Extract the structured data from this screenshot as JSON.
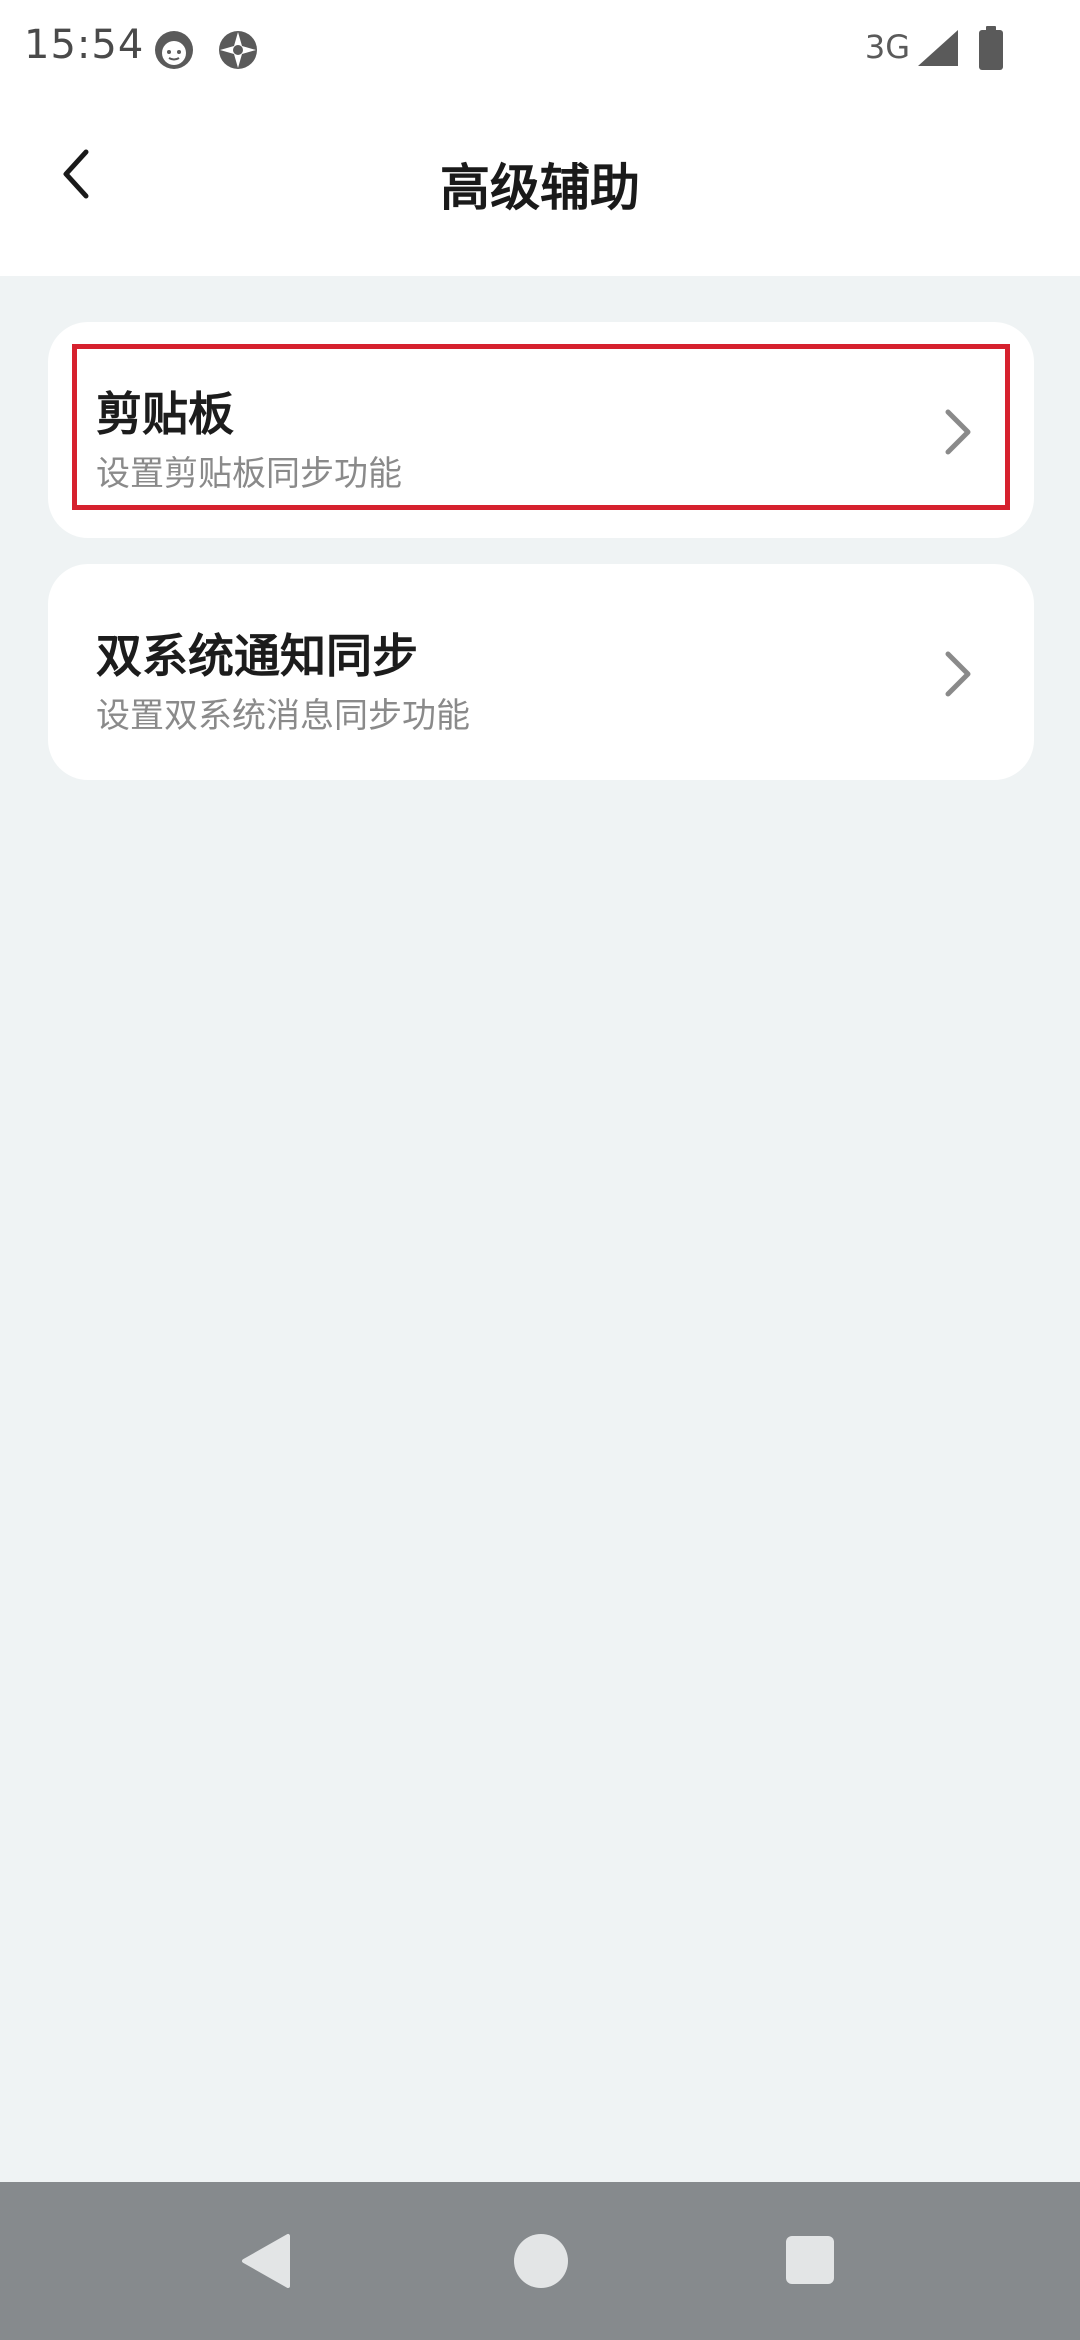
{
  "status_bar": {
    "time": "15:54",
    "network": "3G",
    "icons": [
      "face-icon",
      "browser-icon",
      "signal-icon",
      "battery-icon"
    ]
  },
  "header": {
    "title": "高级辅助",
    "back_icon": "chevron-left-icon"
  },
  "settings": [
    {
      "title": "剪贴板",
      "subtitle": "设置剪贴板同步功能",
      "highlighted": true
    },
    {
      "title": "双系统通知同步",
      "subtitle": "设置双系统消息同步功能",
      "highlighted": false
    }
  ],
  "nav_bar": {
    "icons": [
      "back-triangle-icon",
      "home-circle-icon",
      "recents-square-icon"
    ]
  },
  "colors": {
    "background": "#eff3f4",
    "card": "#ffffff",
    "highlight": "#d6212e",
    "nav_bar": "#868a8d"
  }
}
